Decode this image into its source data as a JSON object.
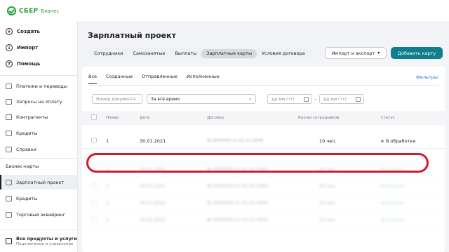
{
  "brand": {
    "name": "СБЕР",
    "sub": "Бизнес",
    "color": "#21a038"
  },
  "sidebar": {
    "actions": [
      {
        "label": "Создать",
        "icon": "plus-icon",
        "glyph": "+"
      },
      {
        "label": "Импорт",
        "icon": "import-icon",
        "glyph": "↓"
      },
      {
        "label": "Помощь",
        "icon": "help-icon",
        "glyph": "?"
      }
    ],
    "items": [
      {
        "label": "Платежи и переводы",
        "icon": "payments-icon"
      },
      {
        "label": "Запросы на оплату",
        "icon": "requests-icon"
      },
      {
        "label": "Контрагенты",
        "icon": "contractors-icon"
      },
      {
        "label": "Кредиты",
        "icon": "credits-icon"
      },
      {
        "label": "Справки",
        "icon": "certificates-icon"
      },
      {
        "label": "Бизнес-карты",
        "icon": "cards-icon"
      },
      {
        "label": "Зарплатный проект",
        "icon": "salary-icon",
        "active": true
      },
      {
        "label": "Кредиты",
        "icon": "credits-icon"
      },
      {
        "label": "Торговый эквайринг",
        "icon": "acquiring-icon"
      }
    ],
    "bottom": {
      "title": "Все продукты и услуги",
      "subtitle": "Подключение и управление",
      "icon": "products-icon"
    }
  },
  "main": {
    "title": "Зарплатный проект",
    "tabs": [
      {
        "label": "Сотрудники"
      },
      {
        "label": "Самозанятые"
      },
      {
        "label": "Выплаты"
      },
      {
        "label": "Зарплатные карты",
        "active": true
      },
      {
        "label": "Условия договора"
      }
    ],
    "import_button": "Импорт и экспорт",
    "add_button": "Добавить карту",
    "accent_color": "#107f8c"
  },
  "card": {
    "subtabs": [
      {
        "label": "Все",
        "active": true
      },
      {
        "label": "Созданные"
      },
      {
        "label": "Отправленные"
      },
      {
        "label": "Исполненные"
      }
    ],
    "filters_link": "Фильтры",
    "filters": {
      "doc_number_placeholder": "Номер документа",
      "period_value": "За всё время",
      "date_from_placeholder": "дд.мм.гггг",
      "date_to_placeholder": "дд.мм.гггг",
      "dash": "–"
    },
    "columns": {
      "number": "Номер",
      "date": "Дата",
      "contract": "Договор",
      "employees": "Кол-во сотрудников",
      "status": "Статус"
    },
    "rows": [
      {
        "number": "1",
        "date": "30.01.2021",
        "contract": "№ 0000000 от 01.01.0000",
        "employees": "10 чел.",
        "status": "В обработке"
      },
      {
        "number": "1",
        "date": "30.01.2021",
        "contract": "№ 0000000 от 01.01.0000",
        "employees": "10 чел.",
        "status": "Исполнен"
      },
      {
        "number": "1",
        "date": "30.01.2021",
        "contract": "№ 0000000 от 01.01.0000",
        "employees": "10 чел.",
        "status": "Исполнен"
      },
      {
        "number": "1",
        "date": "30.01.2021",
        "contract": "№ 0000000 от 01.01.0000",
        "employees": "10 чел.",
        "status": "Исполнен"
      },
      {
        "number": "1",
        "date": "30.01.2021",
        "contract": "№ 0000000 от 01.01.0000",
        "employees": "10 чел.",
        "status": "Исполнен"
      }
    ],
    "highlight_color": "#d21a33"
  }
}
